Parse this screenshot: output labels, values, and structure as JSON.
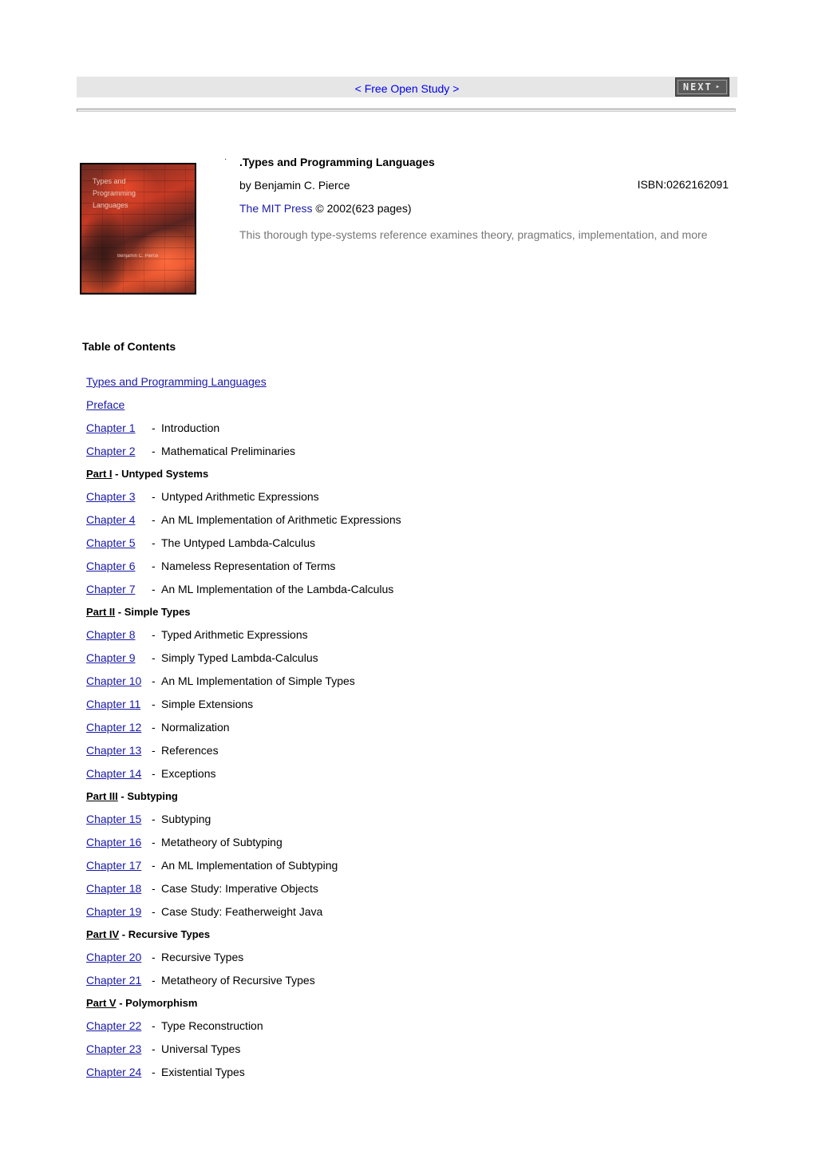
{
  "header": {
    "site_link": "< Free Open Study >",
    "next_button": "NEXT",
    "next_arrow": "▸"
  },
  "book": {
    "bullet": "·",
    "title": ".Types and Programming Languages",
    "author": "by Benjamin C. Pierce",
    "isbn": "ISBN:0262162091",
    "publisher": "The MIT Press",
    "copyright": " © 2002(623 pages)",
    "description": "This thorough type-systems reference examines theory, pragmatics, implementation, and more",
    "cover": {
      "title_lines": [
        "Types and",
        "Programming",
        "Languages"
      ],
      "author": "Benjamin C. Pierce"
    }
  },
  "toc": {
    "heading": "Table of Contents",
    "entries": [
      {
        "kind": "link",
        "label": "Types and Programming Languages"
      },
      {
        "kind": "link",
        "label": "Preface"
      },
      {
        "kind": "chapter",
        "label": "Chapter 1",
        "title": "Introduction"
      },
      {
        "kind": "chapter",
        "label": "Chapter 2",
        "title": "Mathematical Preliminaries"
      },
      {
        "kind": "part",
        "label": "Part I",
        "title": "Untyped Systems"
      },
      {
        "kind": "chapter",
        "label": "Chapter 3",
        "title": "Untyped Arithmetic Expressions"
      },
      {
        "kind": "chapter",
        "label": "Chapter 4",
        "title": "An ML Implementation of Arithmetic Expressions"
      },
      {
        "kind": "chapter",
        "label": "Chapter 5",
        "title": "The Untyped Lambda-Calculus"
      },
      {
        "kind": "chapter",
        "label": "Chapter 6",
        "title": "Nameless Representation of Terms"
      },
      {
        "kind": "chapter",
        "label": "Chapter 7",
        "title": "An ML Implementation of the Lambda-Calculus"
      },
      {
        "kind": "part",
        "label": "Part II",
        "title": "Simple Types"
      },
      {
        "kind": "chapter",
        "label": "Chapter 8",
        "title": "Typed Arithmetic Expressions"
      },
      {
        "kind": "chapter",
        "label": "Chapter 9",
        "title": "Simply Typed Lambda-Calculus"
      },
      {
        "kind": "chapter",
        "label": "Chapter 10",
        "title": "An ML Implementation of Simple Types"
      },
      {
        "kind": "chapter",
        "label": "Chapter 11",
        "title": "Simple Extensions"
      },
      {
        "kind": "chapter",
        "label": "Chapter 12",
        "title": "Normalization"
      },
      {
        "kind": "chapter",
        "label": "Chapter 13",
        "title": "References"
      },
      {
        "kind": "chapter",
        "label": "Chapter 14",
        "title": "Exceptions"
      },
      {
        "kind": "part",
        "label": "Part III",
        "title": "Subtyping"
      },
      {
        "kind": "chapter",
        "label": "Chapter 15",
        "title": "Subtyping"
      },
      {
        "kind": "chapter",
        "label": "Chapter 16",
        "title": "Metatheory of Subtyping"
      },
      {
        "kind": "chapter",
        "label": "Chapter 17",
        "title": "An ML Implementation of Subtyping"
      },
      {
        "kind": "chapter",
        "label": "Chapter 18",
        "title": "Case Study: Imperative Objects"
      },
      {
        "kind": "chapter",
        "label": "Chapter 19",
        "title": "Case Study: Featherweight Java"
      },
      {
        "kind": "part",
        "label": "Part IV",
        "title": "Recursive Types"
      },
      {
        "kind": "chapter",
        "label": "Chapter 20",
        "title": "Recursive Types"
      },
      {
        "kind": "chapter",
        "label": "Chapter 21",
        "title": "Metatheory of Recursive Types"
      },
      {
        "kind": "part",
        "label": "Part V",
        "title": "Polymorphism"
      },
      {
        "kind": "chapter",
        "label": "Chapter 22",
        "title": "Type Reconstruction"
      },
      {
        "kind": "chapter",
        "label": "Chapter 23",
        "title": "Universal Types"
      },
      {
        "kind": "chapter",
        "label": "Chapter 24",
        "title": "Existential Types"
      }
    ]
  }
}
